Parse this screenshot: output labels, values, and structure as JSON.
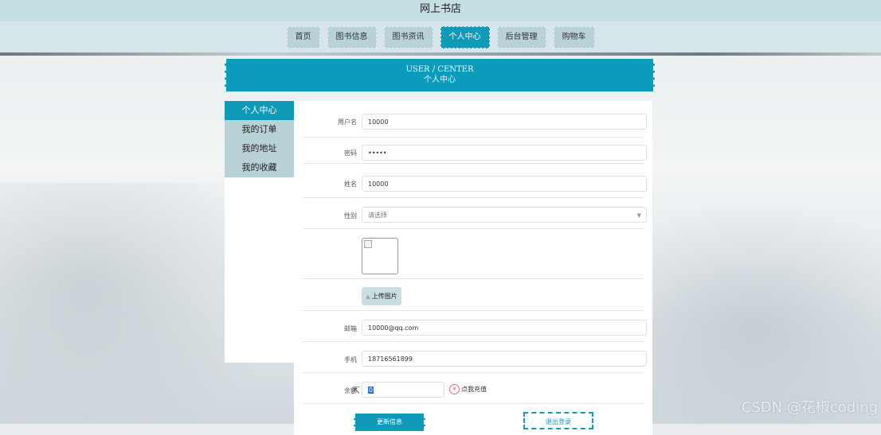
{
  "site_title": "网上书店",
  "nav": [
    {
      "label": "首页",
      "active": false
    },
    {
      "label": "图书信息",
      "active": false
    },
    {
      "label": "图书资讯",
      "active": false
    },
    {
      "label": "个人中心",
      "active": true
    },
    {
      "label": "后台管理",
      "active": false
    },
    {
      "label": "购物车",
      "active": false
    }
  ],
  "banner": {
    "en": "USER / CENTER",
    "cn": "个人中心"
  },
  "sidebar": [
    {
      "label": "个人中心",
      "active": true
    },
    {
      "label": "我的订单",
      "active": false
    },
    {
      "label": "我的地址",
      "active": false
    },
    {
      "label": "我的收藏",
      "active": false
    }
  ],
  "form": {
    "username": {
      "label": "用户名",
      "value": "10000"
    },
    "password": {
      "label": "密码",
      "value": "•••••"
    },
    "name": {
      "label": "姓名",
      "value": "10000"
    },
    "gender": {
      "label": "性别",
      "placeholder": "请选择"
    },
    "upload_label": "上传图片",
    "email": {
      "label": "邮箱",
      "value": "10000@qq.com"
    },
    "phone": {
      "label": "手机",
      "value": "18716561899"
    },
    "balance": {
      "label": "余额",
      "value": "0"
    },
    "recharge_label": "点我充值"
  },
  "buttons": {
    "update": "更新信息",
    "logout": "退出登录"
  },
  "watermark": "CSDN @花椒coding",
  "colors": {
    "accent": "#0e9ab8",
    "nav_bg": "#b9d2d8",
    "topbar_bg": "#c5dfe4"
  }
}
